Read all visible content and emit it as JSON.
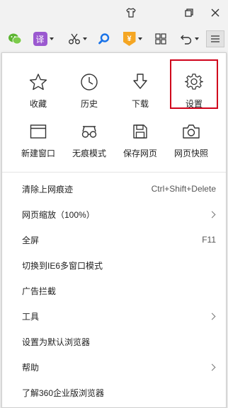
{
  "icons": {
    "titlebar": [
      "shirt-icon",
      "restore-icon",
      "close-icon"
    ],
    "toolbar": [
      "wechat-icon",
      "translate-icon",
      "scissors-icon",
      "search-icon",
      "coupon-icon",
      "apps-icon",
      "undo-icon",
      "menu-icon"
    ]
  },
  "toolbar": {
    "translate_glyph": "译",
    "coupon_glyph": "¥"
  },
  "grid": [
    {
      "label": "收藏",
      "icon": "star-icon"
    },
    {
      "label": "历史",
      "icon": "clock-icon"
    },
    {
      "label": "下载",
      "icon": "download-icon"
    },
    {
      "label": "设置",
      "icon": "gear-icon"
    },
    {
      "label": "新建窗口",
      "icon": "window-icon"
    },
    {
      "label": "无痕模式",
      "icon": "glasses-icon"
    },
    {
      "label": "保存网页",
      "icon": "save-icon"
    },
    {
      "label": "网页快照",
      "icon": "camera-icon"
    }
  ],
  "menu_items": [
    {
      "label": "清除上网痕迹",
      "shortcut": "Ctrl+Shift+Delete"
    },
    {
      "label": "网页缩放（100%）",
      "submenu": true
    },
    {
      "label": "全屏",
      "shortcut": "F11"
    },
    {
      "label": "切换到IE6多窗口模式"
    },
    {
      "label": "广告拦截"
    },
    {
      "label": "工具",
      "submenu": true
    },
    {
      "label": "设置为默认浏览器"
    },
    {
      "label": "帮助",
      "submenu": true
    },
    {
      "label": "了解360企业版浏览器"
    }
  ],
  "colors": {
    "highlight": "#d0021b",
    "wechat": "#5cb531",
    "translate": "#9b59d0",
    "search": "#1a73e8",
    "coupon": "#f5a623"
  }
}
